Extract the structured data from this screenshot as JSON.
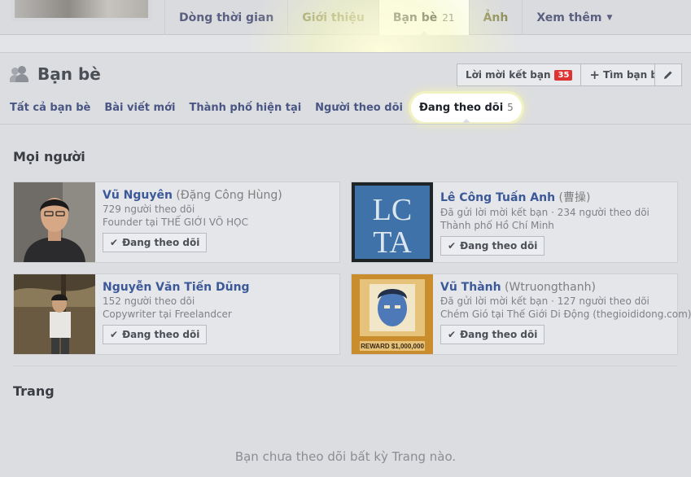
{
  "nav": {
    "tabs": [
      {
        "label": "Dòng thời gian"
      },
      {
        "label": "Giới thiệu"
      },
      {
        "label": "Bạn bè",
        "count": "21"
      },
      {
        "label": "Ảnh"
      },
      {
        "label": "Xem thêm"
      }
    ]
  },
  "header": {
    "title": "Bạn bè",
    "friend_requests_label": "Lời mời kết bạn",
    "friend_requests_count": "35",
    "find_friends_label": "Tìm bạn bè"
  },
  "subtabs": [
    {
      "label": "Tất cả bạn bè"
    },
    {
      "label": "Bài viết mới"
    },
    {
      "label": "Thành phố hiện tại"
    },
    {
      "label": "Người theo dõi"
    },
    {
      "label": "Đang theo dõi",
      "count": "5"
    }
  ],
  "people": {
    "title": "Mọi người",
    "follow_label": "Đang theo dõi",
    "cards": [
      {
        "name": "Vũ Nguyên",
        "alt": "(Đặng Công Hùng)",
        "line1": "729 người theo dõi",
        "line2": "Founder tại THẾ GIỚI VÕ HỌC"
      },
      {
        "name": "Lê Công Tuấn Anh",
        "alt": "(曹操)",
        "line1": "Đã gửi lời mời kết bạn · 234 người theo dõi",
        "line2": "Thành phố Hồ Chí Minh",
        "logo": "LCTA"
      },
      {
        "name": "Nguyễn Văn Tiến Dũng",
        "alt": "",
        "line1": "152 người theo dõi",
        "line2": "Copywriter tại Freelandcer"
      },
      {
        "name": "Vũ Thành",
        "alt": "(Wtruongthanh)",
        "line1": "Đã gửi lời mời kết bạn · 127 người theo dõi",
        "line2": "Chém Gió tại Thế Giới Di Động (thegioididong.com)",
        "poster": "REWARD $1,000,000"
      }
    ]
  },
  "pages": {
    "title": "Trang",
    "empty_text": "Bạn chưa theo dõi bất kỳ Trang nào."
  }
}
